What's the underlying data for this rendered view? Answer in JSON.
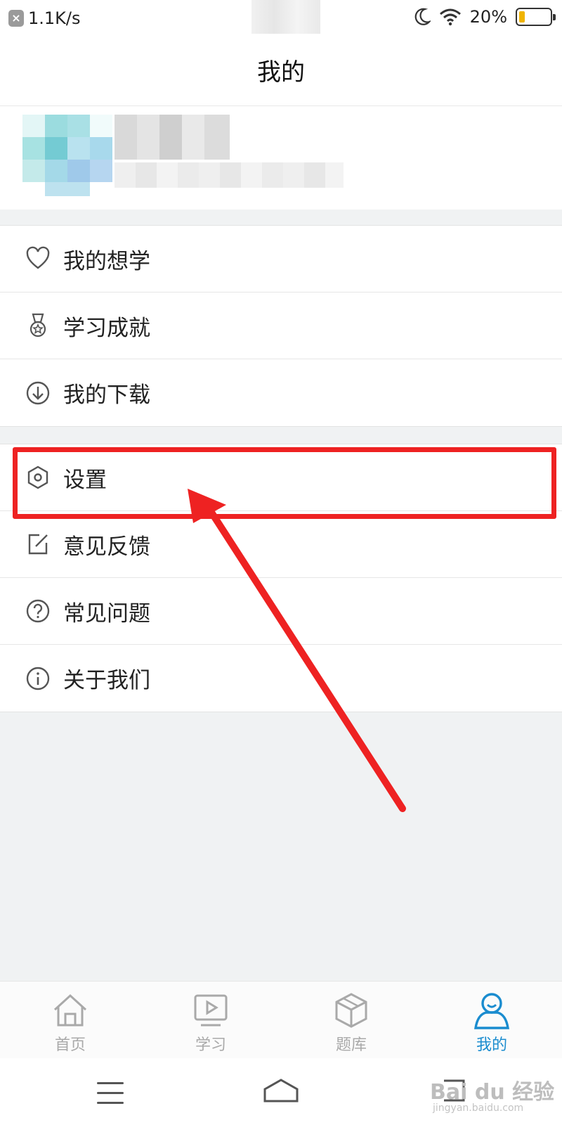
{
  "status_bar": {
    "network_speed": "1.1K/s",
    "battery_percent": "20%",
    "battery_level": 0.2
  },
  "header": {
    "title": "我的"
  },
  "menu": {
    "group1": [
      {
        "label": "我的想学",
        "icon": "heart-icon"
      },
      {
        "label": "学习成就",
        "icon": "medal-icon"
      },
      {
        "label": "我的下载",
        "icon": "download-icon"
      }
    ],
    "group2": [
      {
        "label": "设置",
        "icon": "settings-hex-icon"
      },
      {
        "label": "意见反馈",
        "icon": "edit-icon"
      },
      {
        "label": "常见问题",
        "icon": "question-icon"
      },
      {
        "label": "关于我们",
        "icon": "info-icon"
      }
    ]
  },
  "tabs": [
    {
      "label": "首页",
      "icon": "home-icon",
      "active": false
    },
    {
      "label": "学习",
      "icon": "play-screen-icon",
      "active": false
    },
    {
      "label": "题库",
      "icon": "cube-icon",
      "active": false
    },
    {
      "label": "我的",
      "icon": "person-icon",
      "active": true
    }
  ],
  "colors": {
    "accent": "#1a8ccf",
    "highlight": "#ee2222",
    "inactive_tab": "#a9a9a9",
    "battery": "#f0b400"
  },
  "watermark": {
    "brand": "Bai du 经验",
    "site": "jingyan.baidu.com"
  }
}
